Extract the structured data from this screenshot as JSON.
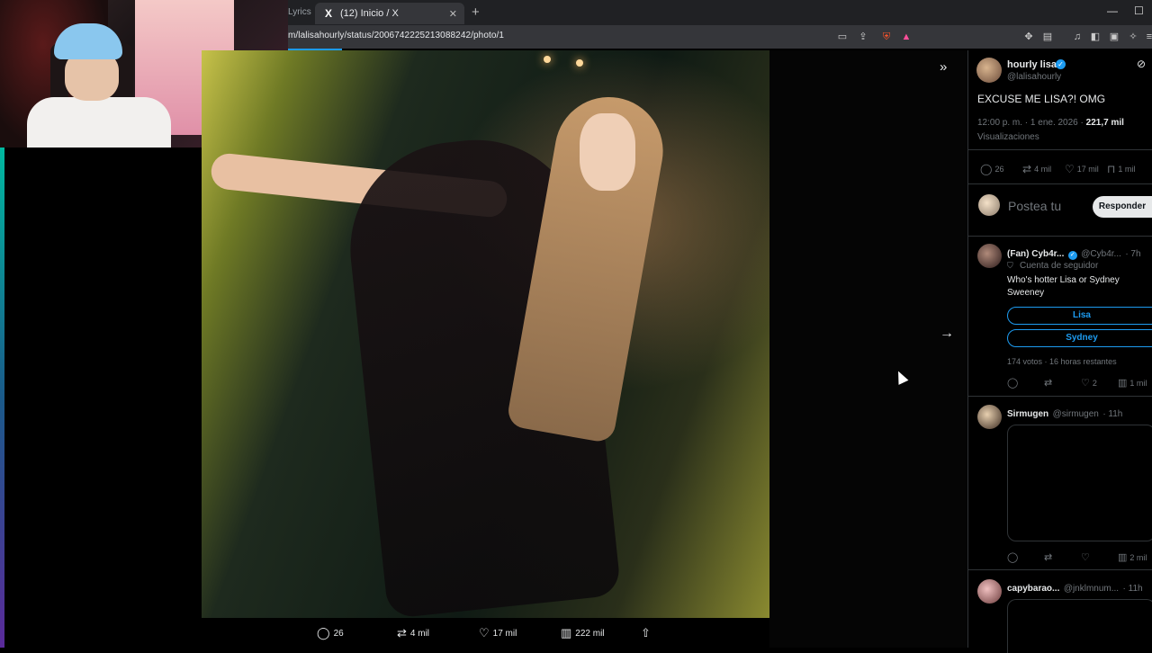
{
  "browser": {
    "prev_tab_label": "Lyrics",
    "active_tab_title": "(12) Inicio / X",
    "active_tab_icon": "x-logo-icon",
    "new_tab_label": "+",
    "tab_close_label": "✕",
    "url": "m/lalisahourly/status/2006742225213088242/photo/1",
    "window_controls": [
      "—",
      "☐"
    ]
  },
  "viewer": {
    "expand_label": "»",
    "next_label": "→",
    "actions": {
      "replies": "26",
      "reposts": "4 mil",
      "likes": "17 mil",
      "views": "222 mil"
    }
  },
  "post": {
    "author_name": "hourly lisa",
    "author_handle": "@lalisahourly",
    "text": "EXCUSE ME LISA?! OMG",
    "time": "12:00 p. m. · 1 ene. 2026 · ",
    "views": "221,7 mil",
    "views_label": "Visualizaciones",
    "stats": {
      "replies": "26",
      "reposts": "4 mil",
      "likes": "17 mil",
      "bookmarks": "1 mil"
    },
    "reply_placeholder": "Postea tu",
    "reply_button": "Responder"
  },
  "replies": [
    {
      "name": "(Fan) Cyb4r...",
      "handle": "@Cyb4r...",
      "age": "· 7h",
      "follower_label": "Cuenta de seguidor",
      "text": "Who's hotter Lisa or Sydney Sweeney",
      "poll_options": [
        "Lisa",
        "Sydney"
      ],
      "poll_meta": "174 votos · 16 horas restantes",
      "likes": "2",
      "views": "1 mil"
    },
    {
      "name": "Sirmugen",
      "handle": "@sirmugen",
      "age": "· 11h",
      "views": "2 mil"
    },
    {
      "name": "capybarao...",
      "handle": "@jnklmnum...",
      "age": "· 11h"
    }
  ],
  "colors": {
    "accent": "#1d9bf0",
    "background": "#000000",
    "text": "#e7e9ea",
    "muted": "#71767b",
    "divider": "#2f3336"
  }
}
